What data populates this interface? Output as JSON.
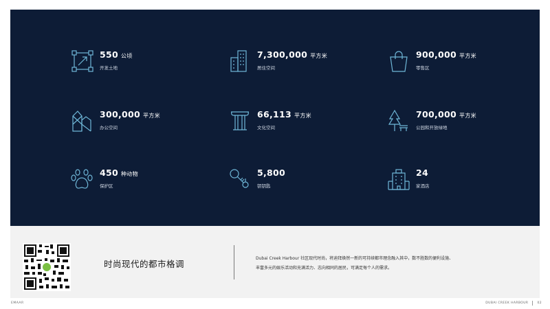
{
  "stats": [
    {
      "num": "550",
      "unit": "公顷",
      "label": "开发土地",
      "icon": "land-icon"
    },
    {
      "num": "7,300,000",
      "unit": "平方米",
      "label": "居住空间",
      "icon": "residential-icon"
    },
    {
      "num": "900,000",
      "unit": "平方米",
      "label": "零售区",
      "icon": "shopping-bag-icon"
    },
    {
      "num": "300,000",
      "unit": "平方米",
      "label": "办公空间",
      "icon": "office-icon"
    },
    {
      "num": "66,113",
      "unit": "平方米",
      "label": "文化空间",
      "icon": "culture-column-icon"
    },
    {
      "num": "700,000",
      "unit": "平方米",
      "label": "公园和开放绿地",
      "icon": "park-tree-icon"
    },
    {
      "num": "450",
      "unit": "种动物",
      "label": "保护区",
      "icon": "paw-icon"
    },
    {
      "num": "5,800",
      "unit": "",
      "label": "钥钥匙",
      "icon": "key-icon"
    },
    {
      "num": "24",
      "unit": "",
      "label": "家酒店",
      "icon": "hotel-icon"
    }
  ],
  "tagline": "时尚现代的都市格调",
  "description": {
    "line1": "Dubai Creek Harbour 社区现代时尚，将迪拜焕然一新的可持续都市理念融入其中，数不胜数的便利设施、",
    "line2": "丰富多元的娱乐活动和充满活力、志向相同的居民，可满足每个人的需求。"
  },
  "footer": {
    "left": "EMAAR",
    "right_title": "DUBAI CREEK HARBOUR",
    "page": "02"
  },
  "colors": {
    "panel": "#0d1c36",
    "icon": "#6fb7d8"
  }
}
